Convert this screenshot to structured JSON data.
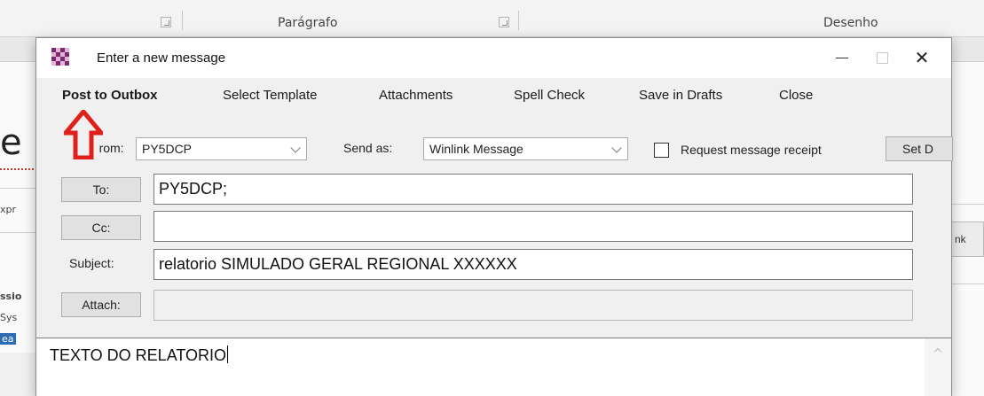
{
  "background": {
    "ribbon_groups": [
      "Parágrafo",
      "Desenho"
    ],
    "big_letter": "e",
    "side_texts": [
      "xpr",
      "ssio",
      "Sys",
      "ea"
    ],
    "right_button_label": "nk"
  },
  "window": {
    "title": "Enter a new message",
    "icon": "checkered-app-icon",
    "controls": [
      "minimize-icon",
      "maximize-icon",
      "close-icon"
    ],
    "close_glyph": "✕"
  },
  "menu": {
    "items": [
      "Post to Outbox",
      "Select Template",
      "Attachments",
      "Spell Check",
      "Save in Drafts",
      "Close"
    ]
  },
  "form": {
    "from_label": "rom:",
    "from_label_prefix": "F",
    "from_value": "PY5DCP",
    "send_as_label": "Send as:",
    "send_as_value": "Winlink Message",
    "request_receipt_label": "Request message receipt",
    "request_receipt_checked": false,
    "set_button_label": "Set D",
    "to_button": "To:",
    "to_value": "PY5DCP;",
    "cc_button": "Cc:",
    "cc_value": "",
    "subject_label": "Subject:",
    "subject_value": "relatorio SIMULADO GERAL REGIONAL XXXXXX",
    "attach_button": "Attach:",
    "attach_value": ""
  },
  "message_body": {
    "text": "TEXTO DO RELATORIO"
  },
  "colors": {
    "annotation_arrow": "#e0201b",
    "app_icon_primary": "#7b2a6f"
  }
}
